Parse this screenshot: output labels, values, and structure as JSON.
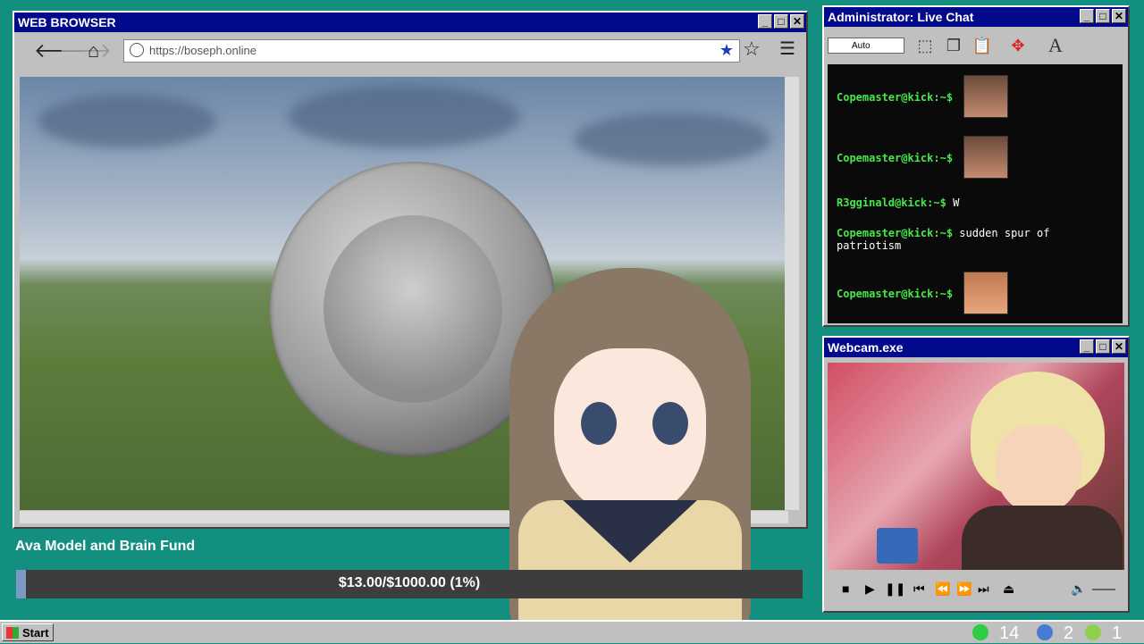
{
  "browser": {
    "title": "WEB BROWSER",
    "url": "https://boseph.online",
    "controls": {
      "min": "_",
      "max": "□",
      "close": "✕"
    }
  },
  "fund": {
    "title": "Ava Model and Brain Fund",
    "progress_text": "$13.00/$1000.00 (1%)",
    "progress_fraction": 0.013
  },
  "chat": {
    "title": "Administrator: Live Chat",
    "font_select": "Auto",
    "messages": [
      {
        "user": "Copemaster@kick:~$",
        "text": "",
        "emote": true
      },
      {
        "user": "Copemaster@kick:~$",
        "text": "",
        "emote": true
      },
      {
        "user": "R3gginald@kick:~$",
        "text": "W",
        "emote": false
      },
      {
        "user": "Copemaster@kick:~$",
        "text": "sudden spur of",
        "text2": "patriotism",
        "emote": false
      },
      {
        "user": "Copemaster@kick:~$",
        "text": "",
        "emote": true
      }
    ]
  },
  "webcam": {
    "title": "Webcam.exe"
  },
  "taskbar": {
    "start_label": "Start",
    "tray_counts": [
      "14",
      "2",
      "1"
    ]
  },
  "colors": {
    "desktop": "#138f7f",
    "titlebar": "#000a8a",
    "chat_user": "#46e84a"
  }
}
